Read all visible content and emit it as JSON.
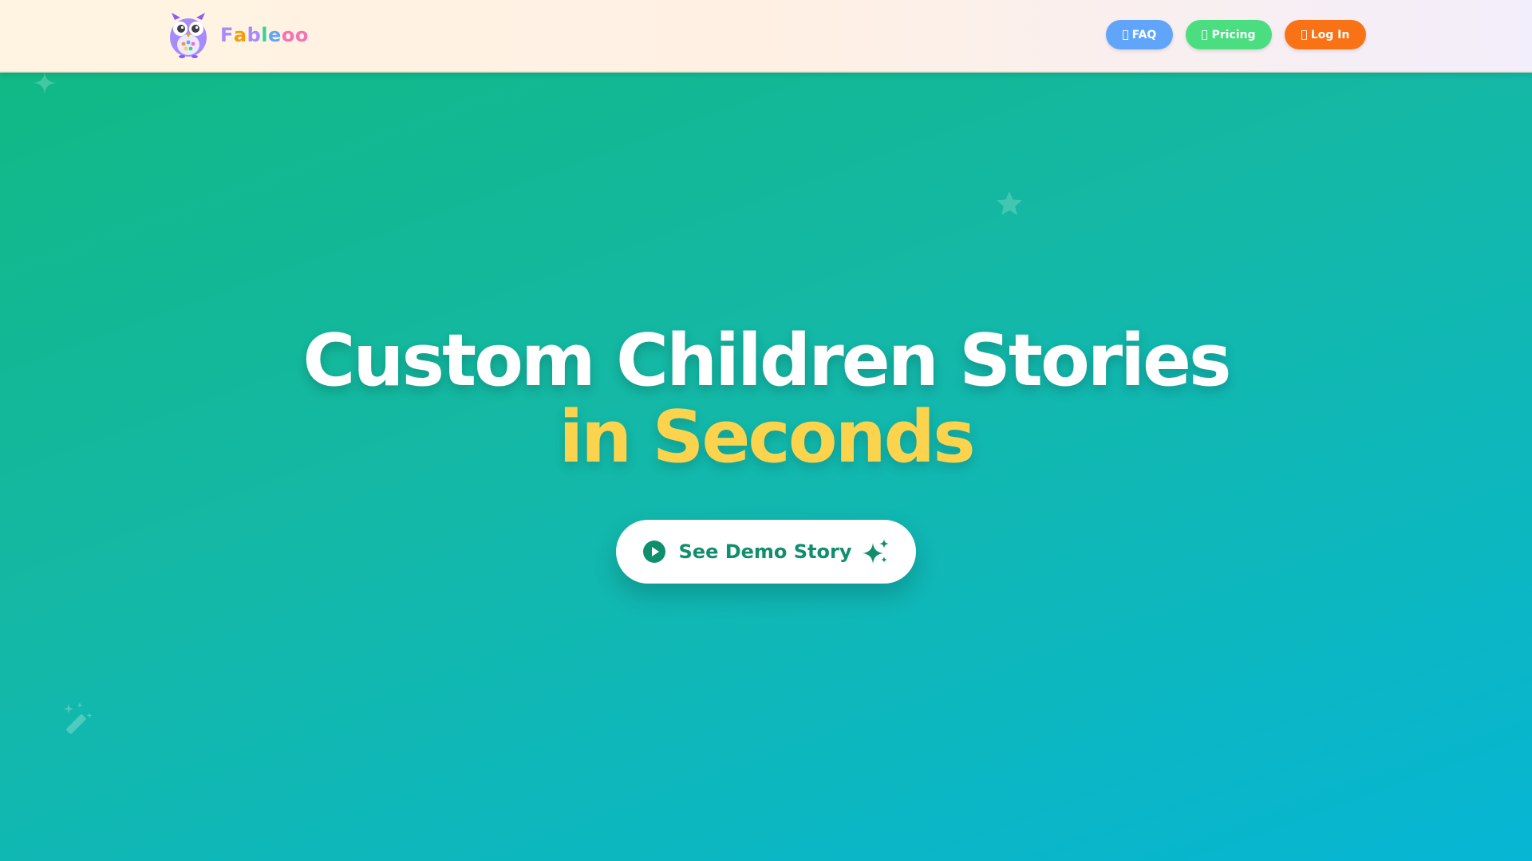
{
  "brand": {
    "name": "Fableoo",
    "letters": [
      {
        "ch": "F",
        "color": "#a78bfa"
      },
      {
        "ch": "a",
        "color": "#f59e0b"
      },
      {
        "ch": "b",
        "color": "#a78bfa"
      },
      {
        "ch": "l",
        "color": "#34d399"
      },
      {
        "ch": "e",
        "color": "#60a5fa"
      },
      {
        "ch": "o",
        "color": "#f472b6"
      },
      {
        "ch": "o",
        "color": "#f472b6"
      }
    ],
    "logo_icon": "owl-logo-icon"
  },
  "nav": {
    "faq_label": "FAQ",
    "pricing_label": "Pricing",
    "login_label": "Log In"
  },
  "hero": {
    "headline_line1": "Custom Children Stories",
    "headline_line2": "in Seconds",
    "cta_label": "See Demo Story",
    "cta_icon_left": "play-circle-icon",
    "cta_icon_right": "sparkles-icon"
  },
  "decorations": [
    "sparkle-icon",
    "star-icon",
    "magic-wand-icon"
  ],
  "colors": {
    "bg_start": "#10b981",
    "bg_end": "#06b6d4",
    "accent_yellow": "#fcd34d",
    "cta_text": "#0f8f6c",
    "faq": "#60a5fa",
    "pricing": "#4ade80",
    "login": "#f97316"
  }
}
